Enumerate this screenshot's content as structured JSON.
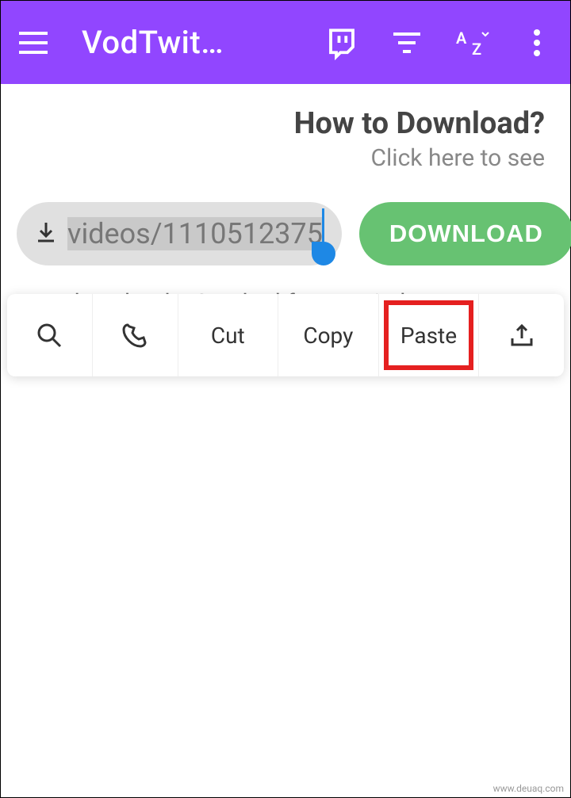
{
  "appbar": {
    "title": "VodTwit…"
  },
  "help": {
    "title": "How to Download?",
    "subtitle": "Click here to see"
  },
  "input": {
    "value": "videos/1110512375"
  },
  "download_button": "DOWNLOAD",
  "empty_state": "No downloads. Send url from Twitch app to start",
  "context_menu": {
    "cut": "Cut",
    "copy": "Copy",
    "paste": "Paste"
  },
  "watermark": "www.deuaq.com"
}
